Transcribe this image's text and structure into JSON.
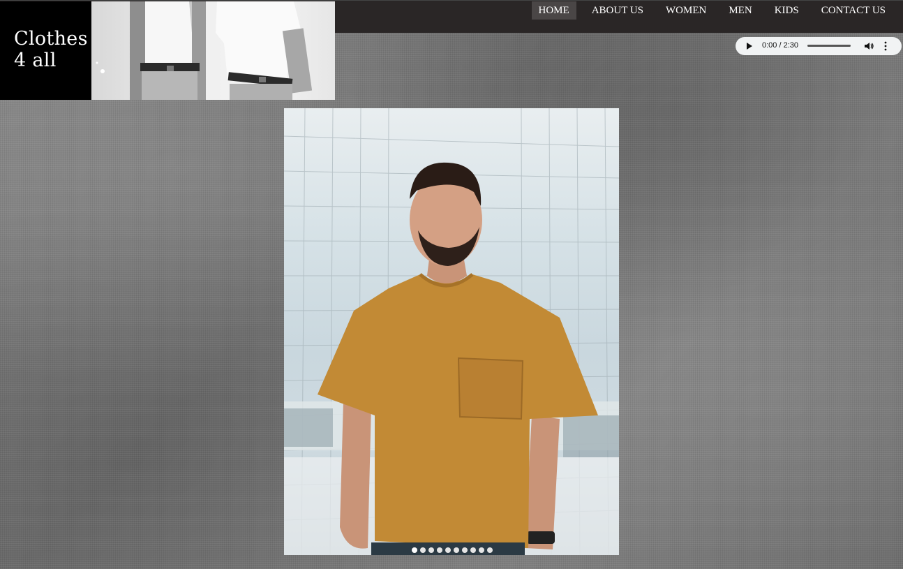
{
  "brand": {
    "name": "Clothes\n4  all"
  },
  "nav": {
    "items": [
      {
        "label": "HOME",
        "active": true
      },
      {
        "label": "ABOUT US",
        "active": false
      },
      {
        "label": "WOMEN",
        "active": false
      },
      {
        "label": "MEN",
        "active": false
      },
      {
        "label": "KIDS",
        "active": false
      },
      {
        "label": "CONTACT US",
        "active": false
      }
    ]
  },
  "audio": {
    "time": "0:00 / 2:30"
  },
  "slideshow": {
    "slide_count": 10,
    "active_index": 0
  },
  "colors": {
    "header_bg": "#2a2626",
    "nav_active_bg": "#4a4646",
    "shirt": "#c28a35"
  },
  "icons": {
    "play": "play-icon",
    "volume": "volume-icon",
    "more": "more-vert-icon"
  }
}
